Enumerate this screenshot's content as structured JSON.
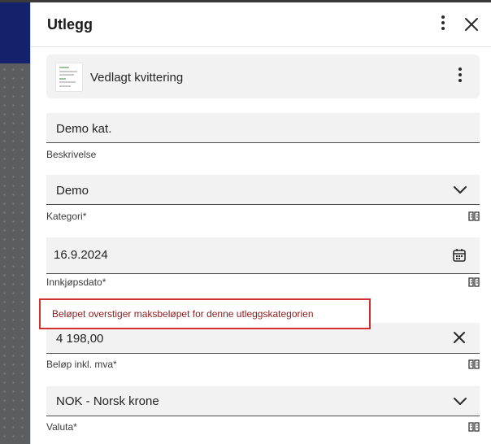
{
  "panel": {
    "title": "Utlegg",
    "header_icons": [
      "more-vert-icon",
      "close-icon"
    ]
  },
  "attachment": {
    "label": "Vedlagt kvittering",
    "icons": [
      "receipt-thumbnail",
      "more-vert-icon"
    ]
  },
  "fields": {
    "description": {
      "value": "Demo kat.",
      "label": "Beskrivelse"
    },
    "category": {
      "value": "Demo",
      "label": "Kategori*",
      "icon": "chevron-down-icon"
    },
    "purchase_date": {
      "value": "16.9.2024",
      "label": "Innkjøpsdato*",
      "icon": "calendar-icon"
    },
    "amount": {
      "value": "4 198,00",
      "label": "Beløp inkl. mva*",
      "icon": "clear-icon",
      "error": "Beløpet overstiger maksbeløpet for denne utleggskategorien"
    },
    "currency": {
      "value": "NOK - Norsk krone",
      "label": "Valuta*",
      "icon": "chevron-down-icon"
    }
  },
  "colors": {
    "error": "#d32f2f",
    "error_text": "#8b1c1c",
    "field_bg": "#f2f2f2",
    "backdrop_top": "#13226a"
  }
}
